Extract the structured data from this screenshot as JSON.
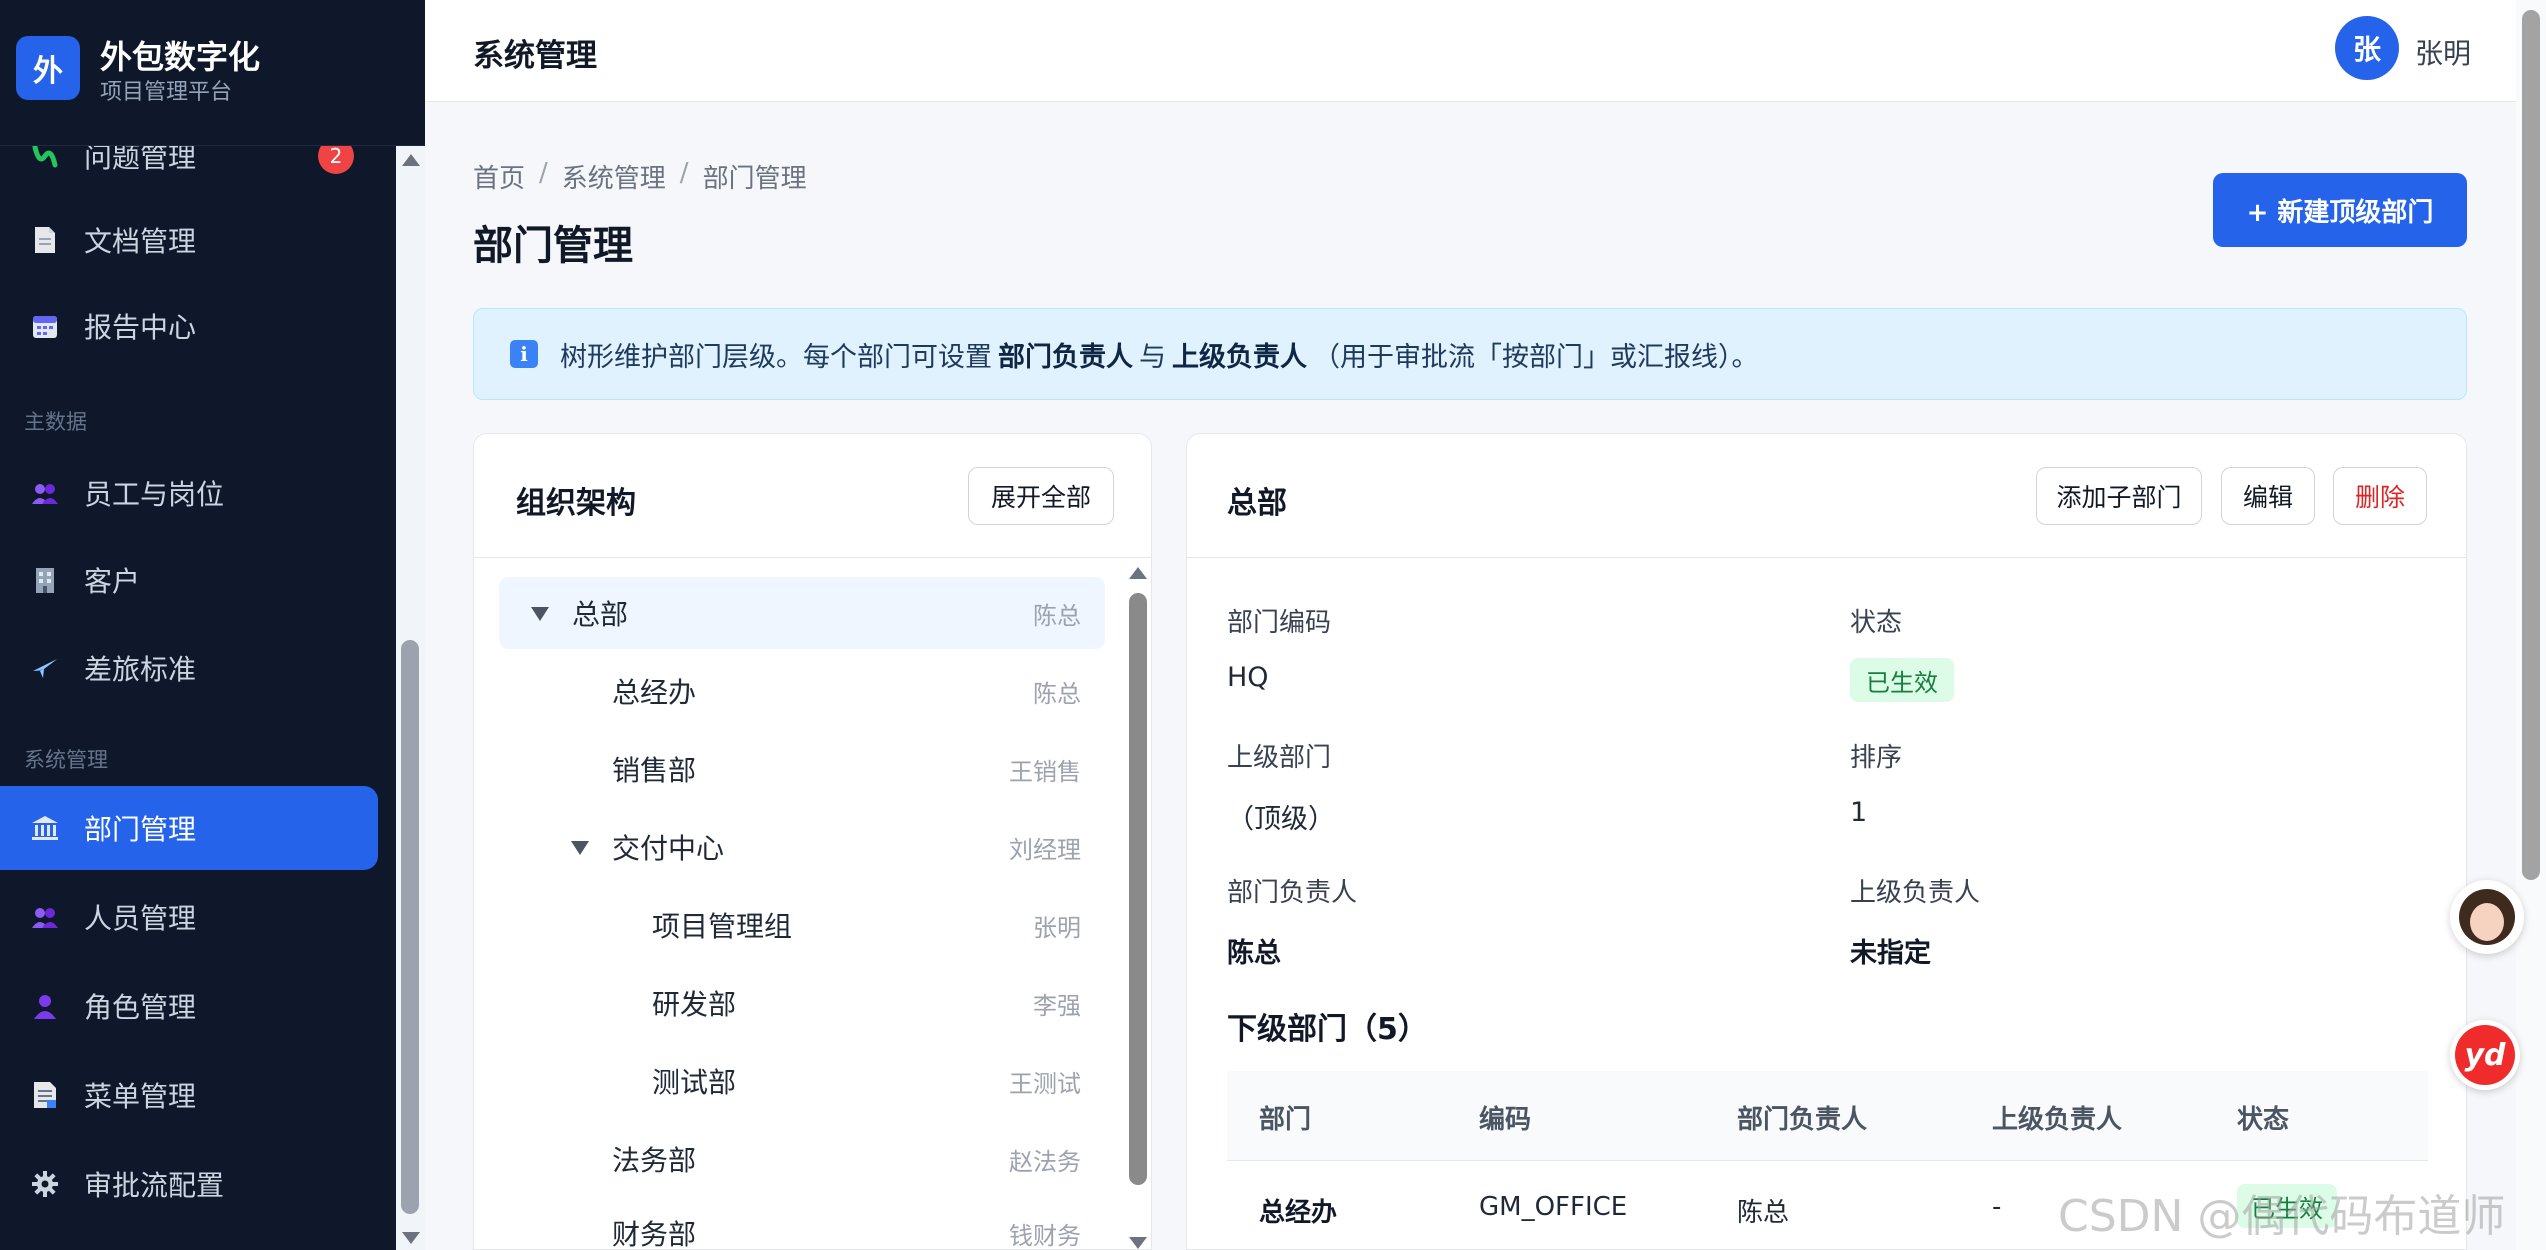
{
  "brand": {
    "logo_char": "外",
    "title": "外包数字化",
    "subtitle": "项目管理平台"
  },
  "sidebar": {
    "items": [
      {
        "label": "问题管理",
        "icon": "issue-icon",
        "badge": "2"
      },
      {
        "label": "文档管理",
        "icon": "document-icon"
      },
      {
        "label": "报告中心",
        "icon": "calendar-report-icon"
      },
      {
        "label": "员工与岗位",
        "icon": "people-icon"
      },
      {
        "label": "客户",
        "icon": "building-icon"
      },
      {
        "label": "差旅标准",
        "icon": "airplane-icon"
      },
      {
        "label": "部门管理",
        "icon": "bank-icon",
        "active": true
      },
      {
        "label": "人员管理",
        "icon": "people-icon"
      },
      {
        "label": "角色管理",
        "icon": "person-icon"
      },
      {
        "label": "菜单管理",
        "icon": "menu-doc-icon"
      },
      {
        "label": "审批流配置",
        "icon": "gear-icon"
      }
    ],
    "groups": {
      "master_data": "主数据",
      "system": "系统管理"
    }
  },
  "topbar": {
    "title": "系统管理",
    "avatar_char": "张",
    "username": "张明"
  },
  "breadcrumb": [
    "首页",
    "系统管理",
    "部门管理"
  ],
  "page": {
    "title": "部门管理",
    "new_button": "+ 新建顶级部门"
  },
  "info": {
    "part1": "树形维护部门层级。每个部门可设置",
    "bold1": "部门负责人",
    "part2": "与",
    "bold2": "上级负责人",
    "part3": "（用于审批流「按部门」或汇报线）。"
  },
  "org": {
    "title": "组织架构",
    "expand_all": "展开全部",
    "nodes": [
      {
        "name": "总部",
        "lead": "陈总",
        "level": 0,
        "expanded": true,
        "selected": true
      },
      {
        "name": "总经办",
        "lead": "陈总",
        "level": 1
      },
      {
        "name": "销售部",
        "lead": "王销售",
        "level": 1
      },
      {
        "name": "交付中心",
        "lead": "刘经理",
        "level": 1,
        "expanded": true
      },
      {
        "name": "项目管理组",
        "lead": "张明",
        "level": 2
      },
      {
        "name": "研发部",
        "lead": "李强",
        "level": 2
      },
      {
        "name": "测试部",
        "lead": "王测试",
        "level": 2
      },
      {
        "name": "法务部",
        "lead": "赵法务",
        "level": 1
      },
      {
        "name": "财务部",
        "lead": "钱财务",
        "level": 1
      }
    ]
  },
  "detail": {
    "title": "总部",
    "actions": {
      "add_child": "添加子部门",
      "edit": "编辑",
      "delete": "删除"
    },
    "fields": {
      "code_label": "部门编码",
      "code": "HQ",
      "status_label": "状态",
      "status": "已生效",
      "parent_label": "上级部门",
      "parent": "（顶级）",
      "order_label": "排序",
      "order": "1",
      "lead_label": "部门负责人",
      "lead": "陈总",
      "superior_label": "上级负责人",
      "superior": "未指定"
    },
    "children_title": "下级部门（5）",
    "table": {
      "headers": [
        "部门",
        "编码",
        "部门负责人",
        "上级负责人",
        "状态"
      ],
      "rows": [
        {
          "name": "总经办",
          "code": "GM_OFFICE",
          "lead": "陈总",
          "superior": "-",
          "status": "已生效"
        }
      ]
    }
  },
  "colors": {
    "primary": "#2563eb",
    "sidebar_bg": "#0f172a",
    "success_bg": "#dcfce7",
    "success_fg": "#15803d",
    "danger": "#dc2626"
  },
  "watermark": "CSDN @偶代码布道师"
}
